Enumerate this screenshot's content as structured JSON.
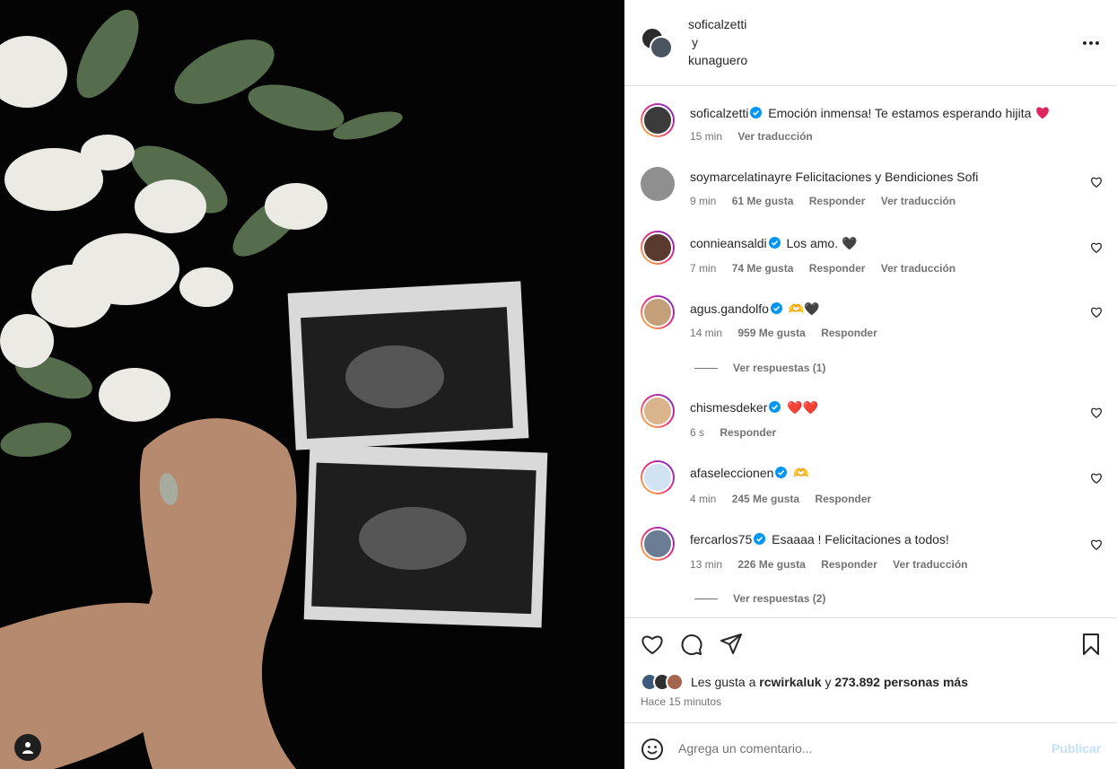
{
  "post": {
    "authors": [
      "soficalzetti",
      "kunaguero"
    ],
    "joiner": "y",
    "caption": {
      "username": "soficalzetti",
      "text": "Emoción inmensa! Te estamos esperando hijita",
      "time": "15 min",
      "translate": "Ver traducción"
    }
  },
  "comments": [
    {
      "username": "soymarcelatinayre",
      "verified": false,
      "text": "Felicitaciones y Bendiciones Sofi",
      "time": "9 min",
      "likes": "61 Me gusta",
      "reply": "Responder",
      "translate": "Ver traducción"
    },
    {
      "username": "connieansaldi",
      "verified": true,
      "text": "Los amo. 🖤",
      "time": "7 min",
      "likes": "74 Me gusta",
      "reply": "Responder",
      "translate": "Ver traducción"
    },
    {
      "username": "agus.gandolfo",
      "verified": true,
      "text": "🫶🖤",
      "time": "14 min",
      "likes": "959 Me gusta",
      "reply": "Responder",
      "replies": "Ver respuestas (1)"
    },
    {
      "username": "chismesdeker",
      "verified": true,
      "text": "❤️❤️",
      "time": "6 s",
      "reply": "Responder"
    },
    {
      "username": "afaseleccionen",
      "verified": true,
      "text": "🫶",
      "time": "4 min",
      "likes": "245 Me gusta",
      "reply": "Responder"
    },
    {
      "username": "fercarlos75",
      "verified": true,
      "text": "Esaaaa ! Felicitaciones a todos!",
      "time": "13 min",
      "likes": "226 Me gusta",
      "reply": "Responder",
      "translate": "Ver traducción",
      "replies": "Ver respuestas (2)"
    }
  ],
  "likes": {
    "prefix": "Les gusta a",
    "user": "rcwirkaluk",
    "joiner": "y",
    "others": "273.892 personas más"
  },
  "time_ago": "Hace 15 minutos",
  "composer": {
    "placeholder": "Agrega un comentario...",
    "publish": "Publicar"
  },
  "icons": {
    "like": "heart-icon",
    "comment": "comment-icon",
    "share": "send-icon",
    "save": "bookmark-icon",
    "more": "more-icon",
    "emoji": "emoji-icon",
    "user_tag": "user-tag-icon"
  },
  "colors": {
    "verified": "#0095f6",
    "heart_red": "#e0245e",
    "publish_disabled": "#c0dffd",
    "secondary_text": "#737373"
  }
}
